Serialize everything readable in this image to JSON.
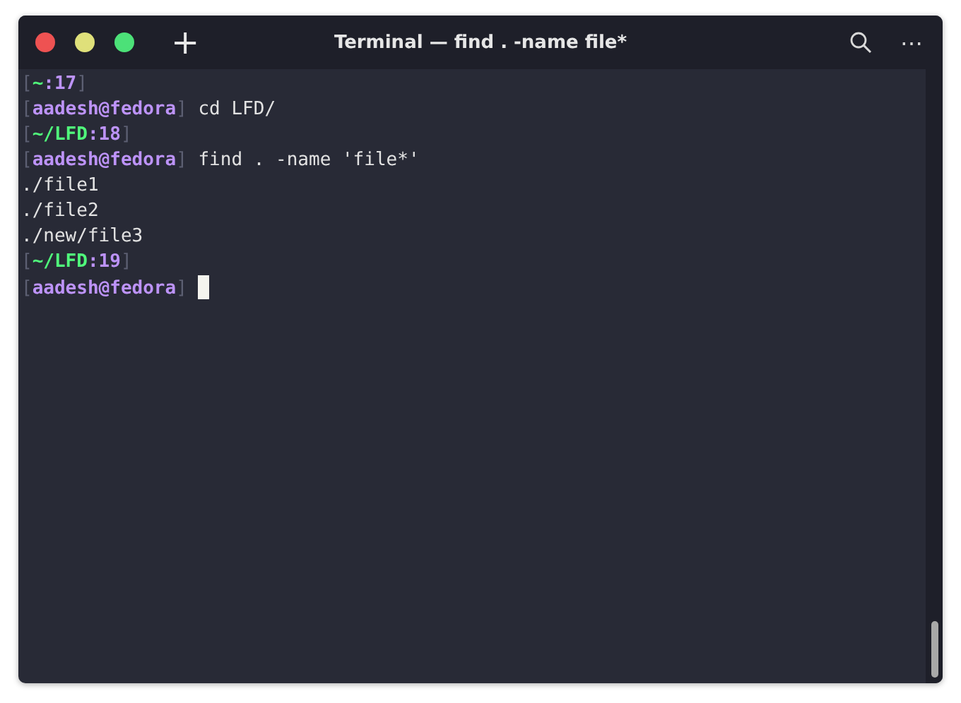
{
  "window": {
    "title": "Terminal — find . -name file*",
    "new_tab": "+",
    "menu": "⋯"
  },
  "lines": [
    {
      "segments": [
        {
          "kind": "bracket",
          "text": "["
        },
        {
          "kind": "path",
          "text": "~"
        },
        {
          "kind": "number",
          "text": ":17"
        },
        {
          "kind": "bracket",
          "text": "]"
        }
      ]
    },
    {
      "segments": [
        {
          "kind": "bracket",
          "text": "["
        },
        {
          "kind": "user",
          "text": "aadesh@fedora"
        },
        {
          "kind": "bracket",
          "text": "]"
        },
        {
          "kind": "plain",
          "text": " cd LFD/"
        }
      ]
    },
    {
      "segments": [
        {
          "kind": "bracket",
          "text": "["
        },
        {
          "kind": "path",
          "text": "~/LFD"
        },
        {
          "kind": "number",
          "text": ":18"
        },
        {
          "kind": "bracket",
          "text": "]"
        }
      ]
    },
    {
      "segments": [
        {
          "kind": "bracket",
          "text": "["
        },
        {
          "kind": "user",
          "text": "aadesh@fedora"
        },
        {
          "kind": "bracket",
          "text": "]"
        },
        {
          "kind": "plain",
          "text": " find . -name 'file*'"
        }
      ]
    },
    {
      "segments": [
        {
          "kind": "plain",
          "text": "./file1"
        }
      ]
    },
    {
      "segments": [
        {
          "kind": "plain",
          "text": "./file2"
        }
      ]
    },
    {
      "segments": [
        {
          "kind": "plain",
          "text": "./new/file3"
        }
      ]
    },
    {
      "segments": [
        {
          "kind": "bracket",
          "text": "["
        },
        {
          "kind": "path",
          "text": "~/LFD"
        },
        {
          "kind": "number",
          "text": ":19"
        },
        {
          "kind": "bracket",
          "text": "]"
        }
      ]
    },
    {
      "segments": [
        {
          "kind": "bracket",
          "text": "["
        },
        {
          "kind": "user",
          "text": "aadesh@fedora"
        },
        {
          "kind": "bracket",
          "text": "]"
        }
      ],
      "cursor": true
    }
  ]
}
